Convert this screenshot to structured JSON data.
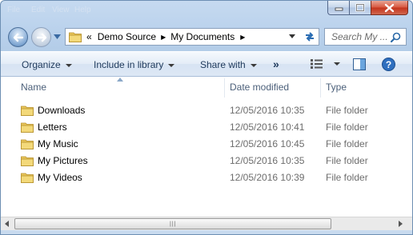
{
  "window": {
    "menu_ghost": [
      "File",
      "Edit",
      "View",
      "Help"
    ]
  },
  "address": {
    "overflow_marker": "«",
    "crumbs": [
      "Demo Source",
      "My Documents"
    ],
    "separator": "▶"
  },
  "search": {
    "placeholder": "Search My ..."
  },
  "toolbar": {
    "organize": "Organize",
    "include_in_library": "Include in library",
    "share_with": "Share with",
    "more": "»"
  },
  "columns": {
    "name": "Name",
    "date_modified": "Date modified",
    "type": "Type"
  },
  "files": [
    {
      "name": "Downloads",
      "date": "12/05/2016 10:35",
      "type": "File folder"
    },
    {
      "name": "Letters",
      "date": "12/05/2016 10:41",
      "type": "File folder"
    },
    {
      "name": "My Music",
      "date": "12/05/2016 10:45",
      "type": "File folder"
    },
    {
      "name": "My Pictures",
      "date": "12/05/2016 10:35",
      "type": "File folder"
    },
    {
      "name": "My Videos",
      "date": "12/05/2016 10:39",
      "type": "File folder"
    }
  ],
  "icons": {
    "back": "back-arrow-icon",
    "forward": "forward-arrow-icon",
    "folder": "folder-icon",
    "refresh": "refresh-icon",
    "search": "search-icon",
    "views": "views-icon",
    "preview_pane": "preview-pane-icon",
    "help": "help-icon"
  },
  "colors": {
    "accent": "#2b6db3",
    "folder": "#e9c65a",
    "close": "#c3331b"
  }
}
